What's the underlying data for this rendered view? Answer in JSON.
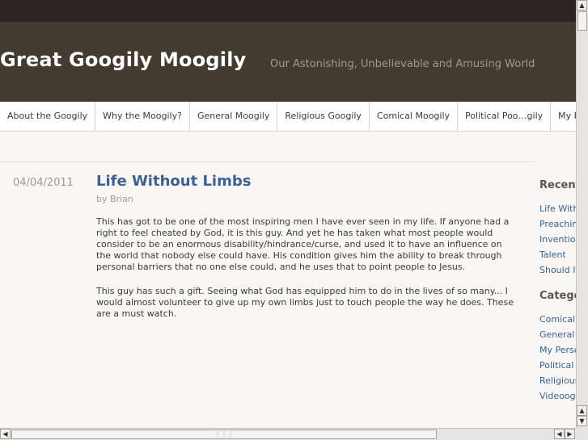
{
  "site": {
    "title": "Great Googily Moogily",
    "tagline": "Our Astonishing, Unbelievable and Amusing World"
  },
  "nav": {
    "items": [
      {
        "label": "About the Googily"
      },
      {
        "label": "Why the Moogily?"
      },
      {
        "label": "General Moogily"
      },
      {
        "label": "Religious Googily"
      },
      {
        "label": "Comical Moogily"
      },
      {
        "label": "Political Poo…gily"
      },
      {
        "label": "My Personal"
      }
    ]
  },
  "post": {
    "date": "04/04/2011",
    "title": "Life Without Limbs",
    "author": "by Brian",
    "paragraphs": [
      "This has got to be one of the most inspiring men I have ever seen in my life. If anyone had a right to feel cheated by God, it is this guy. And yet he has taken what most people would consider to be an enormous disability/hindrance/curse, and used it to have an influence on the world that nobody else could have. His condition gives him the ability to break through personal barriers that no one else could, and he uses that to point people to Jesus.",
      "This guy has such a gift. Seeing what God has equipped him to do in the lives of so many... I would almost volunteer to give up my own limbs just to touch people the way he does. These are a must watch."
    ]
  },
  "sidebar": {
    "recent_heading": "Recent",
    "recent_items": [
      "Life Witho",
      "Preachin",
      "Invention",
      "Talent",
      "Should Is"
    ],
    "categories_heading": "Catego",
    "category_items": [
      "Comical",
      "General",
      "My Perso",
      "Political F",
      "Religious",
      "Videoogi"
    ]
  },
  "icons": {
    "scroll_up": "arrow-up-icon",
    "scroll_down": "arrow-down-icon",
    "scroll_left": "arrow-left-icon",
    "scroll_right": "arrow-right-icon"
  },
  "colors": {
    "header_bg": "#433a30",
    "topbar_bg": "#2c2620",
    "link": "#3c6192",
    "tagline": "#a39a86"
  }
}
